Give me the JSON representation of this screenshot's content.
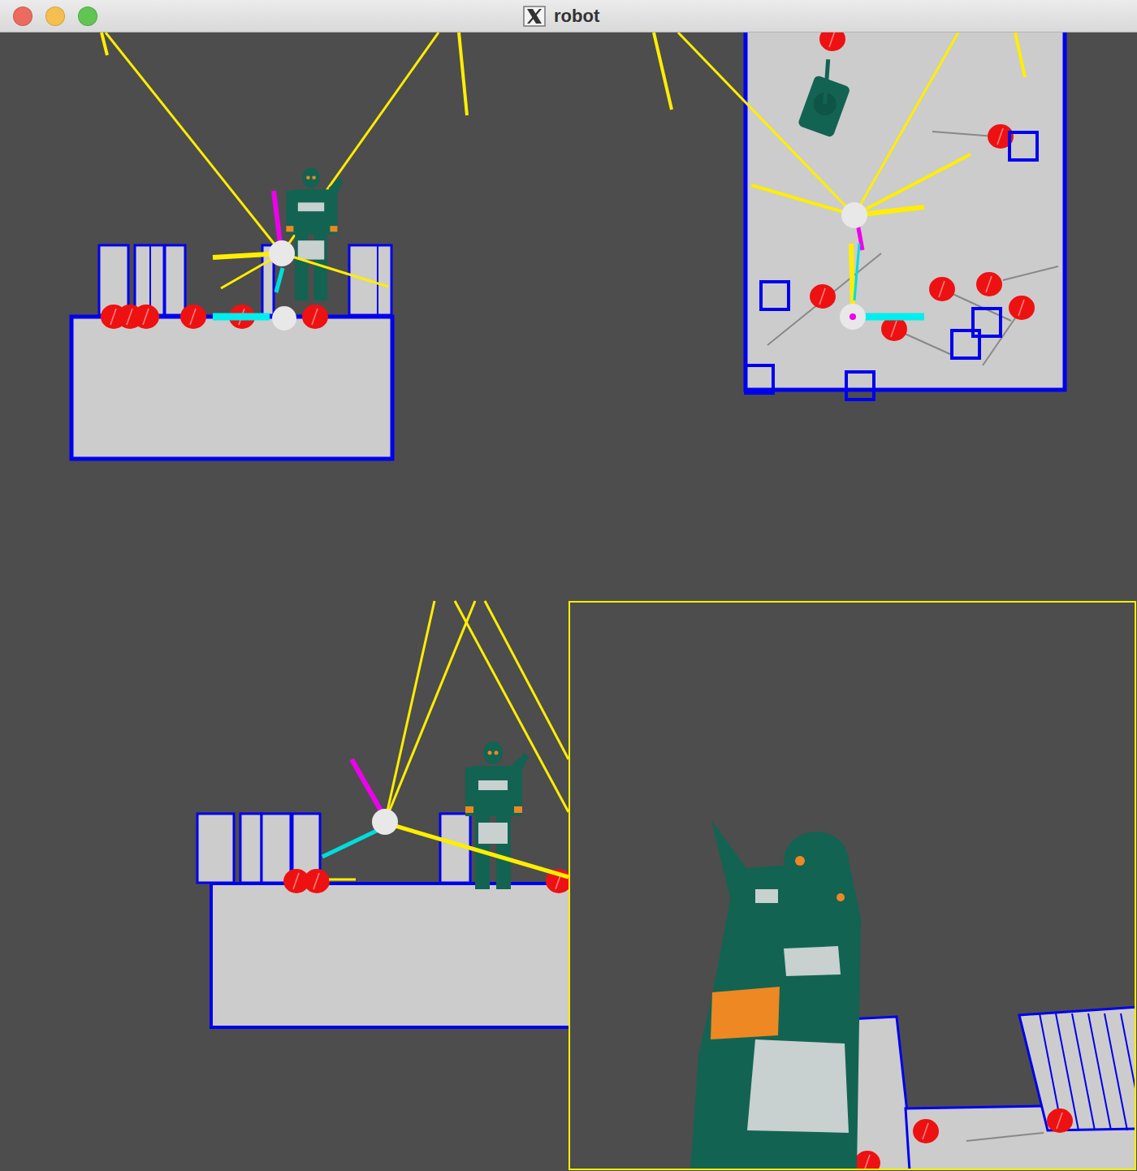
{
  "window": {
    "title": "robot",
    "controls": [
      {
        "color": "#ed6a5e"
      },
      {
        "color": "#f5bf4f"
      },
      {
        "color": "#61c554"
      }
    ]
  },
  "views": [
    {
      "kind": "front"
    },
    {
      "kind": "top"
    },
    {
      "kind": "side"
    },
    {
      "kind": "camera"
    }
  ]
}
